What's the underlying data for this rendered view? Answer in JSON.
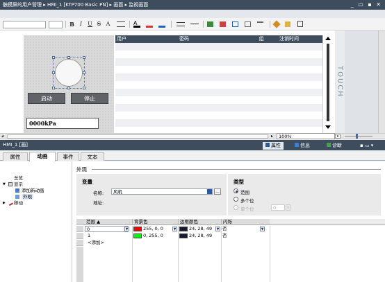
{
  "window": {
    "title": "触摸屏的用户管理 ▸ HMI_1 [KTP700 Basic PN] ▸ 画面 ▸ 监视画面",
    "controls": "_ ▭ ▪ ✕"
  },
  "toolbar": {
    "bold": "B",
    "italic": "I",
    "underline": "U",
    "strike": "S",
    "superscript": "A",
    "superscript_mark": "±"
  },
  "hmi_screen": {
    "start_button": "启动",
    "stop_button": "停止",
    "io_field_value": "0000kPa"
  },
  "user_table": {
    "headers": [
      "用户",
      "密码",
      "组",
      "注销时间"
    ],
    "row_count": 12
  },
  "touch_label": "TOUCH",
  "zoom": "100%",
  "inspector": {
    "title": "HMI_1 [画]",
    "tabs": [
      {
        "label": "属性",
        "icon": "properties-icon"
      },
      {
        "label": "信息",
        "icon": "info-icon"
      },
      {
        "label": "诊断",
        "icon": "diagnostics-icon"
      }
    ],
    "sub_tabs": [
      "属性",
      "动画",
      "事件",
      "文本"
    ],
    "active_sub_tab": "动画"
  },
  "nav": {
    "items": [
      "总览",
      "显示",
      "添加新动画",
      "外观",
      "移动"
    ]
  },
  "appearance": {
    "heading": "外观",
    "variable_group": "变量",
    "name_label": "名称:",
    "name_value": "风机",
    "address_label": "地址:",
    "type_group": "类型",
    "type_options": [
      "范围",
      "多个位",
      "单个位"
    ],
    "single_bit_value": "0"
  },
  "grid": {
    "headers": [
      "范围",
      "背景色",
      "边框颜色",
      "闪烁"
    ],
    "rows": [
      {
        "range": "0",
        "bg_text": "255, 0, 0",
        "bg_color": "#ff0000",
        "border_text": "24, 28, 49",
        "border_color": "#181c31",
        "flash": "否"
      },
      {
        "range": "1",
        "bg_text": "0, 255, 0",
        "bg_color": "#00ff00",
        "border_text": "24, 28, 49",
        "border_color": "#181c31",
        "flash": "否"
      }
    ],
    "add_row": "<添加>"
  }
}
